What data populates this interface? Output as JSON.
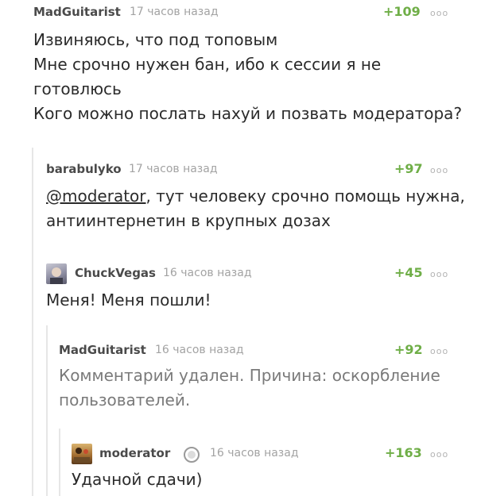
{
  "comments": [
    {
      "author": "MadGuitarist",
      "time": "17 часов назад",
      "rating": "+109",
      "body": [
        "Извиняюсь, что под топовым",
        "Мне срочно нужен бан, ибо к сессии я не",
        "готовлюсь",
        "Кого можно послать нахуй и позвать модератора?"
      ]
    },
    {
      "author": "barabulyko",
      "time": "17 часов назад",
      "rating": "+97",
      "mention": "@moderator",
      "body": [
        ", тут человеку срочно помощь нужна,",
        "антиинтернетин в крупных дозах"
      ]
    },
    {
      "author": "ChuckVegas",
      "time": "16 часов назад",
      "rating": "+45",
      "body": [
        "Меня! Меня пошли!"
      ]
    },
    {
      "author": "MadGuitarist",
      "time": "16 часов назад",
      "rating": "+92",
      "body": [
        "Комментарий удален. Причина: оскорбление",
        "пользователей."
      ]
    },
    {
      "author": "moderator",
      "time": "16 часов назад",
      "rating": "+163",
      "body": [
        "Удачной сдачи)"
      ]
    }
  ],
  "dots_glyph": "ooo",
  "colors": {
    "rating": "#6fae47",
    "author": "#4a4a4a",
    "time": "#a3a3a3",
    "thread_line": "#e6e6e6"
  }
}
